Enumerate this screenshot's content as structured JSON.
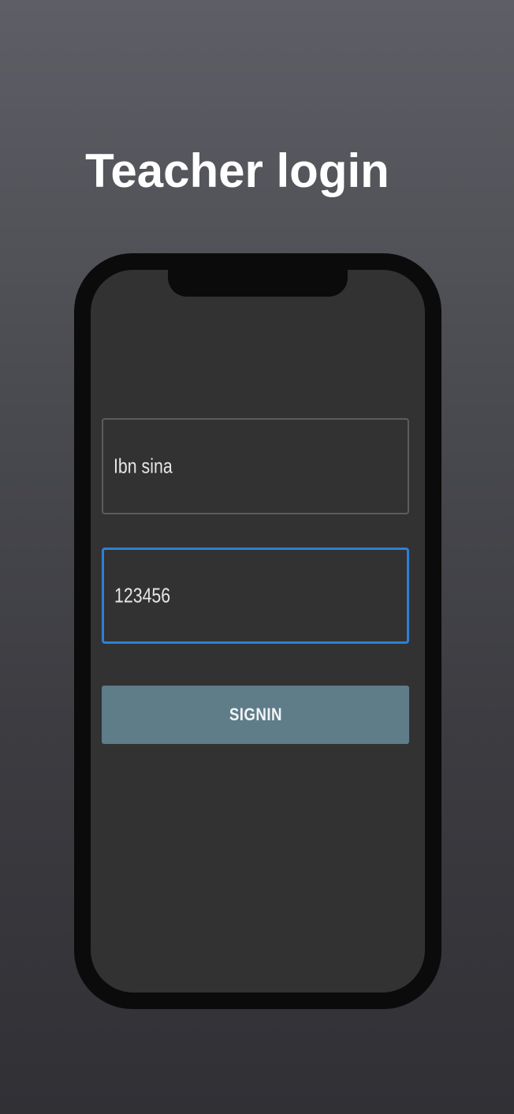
{
  "header": {
    "title": "Teacher login"
  },
  "login_form": {
    "username_value": "Ibn sina",
    "password_value": "123456",
    "signin_label": "SIGNIN"
  },
  "colors": {
    "focus_border": "#2e7fd6",
    "button_bg": "#5f7c89",
    "screen_bg": "#323232"
  }
}
